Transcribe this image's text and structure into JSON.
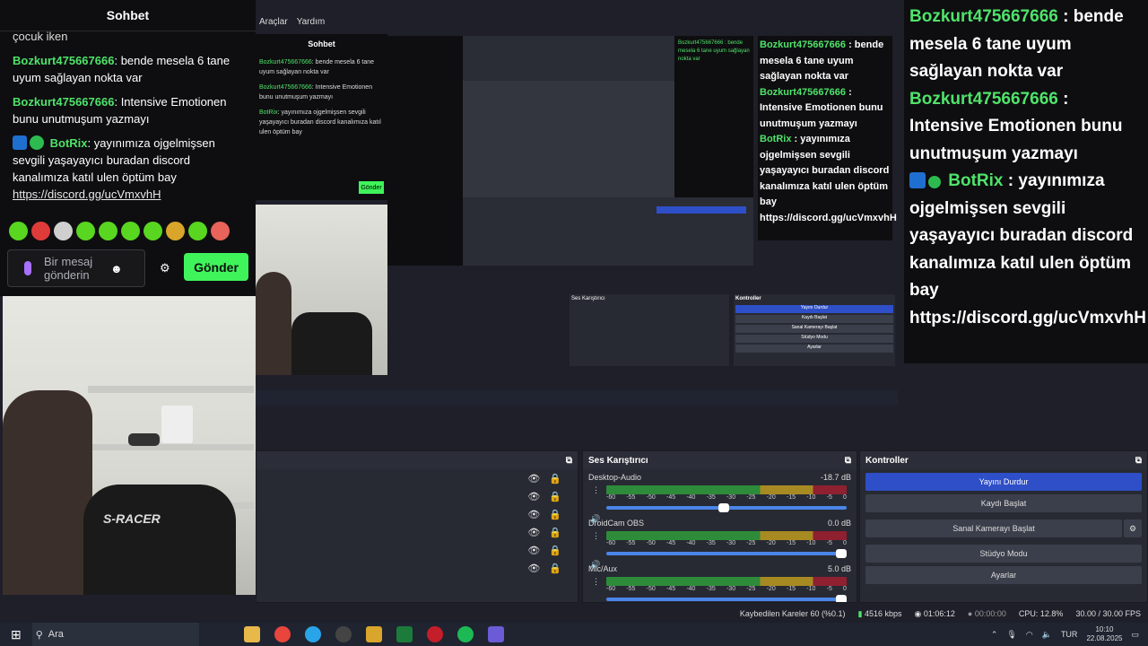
{
  "chat": {
    "header": "Sohbet",
    "partial_text": "çocuk iken",
    "messages": [
      {
        "user": "Bozkurt475667666",
        "text": ": bende mesela 6 tane uyum sağlayan nokta var"
      },
      {
        "user": "Bozkurt475667666",
        "text": ": Intensive Emotionen bunu unutmuşum yazmayı"
      },
      {
        "user": "BotRix",
        "text": ": yayınımıza ojgelmişsen sevgili yaşayayıcı buradan discord kanalımıza katıl ulen öptüm bay",
        "link": "https://discord.gg/ucVmxvhH"
      }
    ],
    "input_placeholder": "Bir mesaj gönderin",
    "send_label": "Gönder"
  },
  "overlay_chat": {
    "messages": [
      {
        "user": "Bozkurt475667666",
        "text": " : bende mesela 6 tane uyum sağlayan nokta var"
      },
      {
        "user": "Bozkurt475667666",
        "text": " : Intensive Emotionen bunu unutmuşum yazmayı"
      },
      {
        "user": "BotRix",
        "text": " : yayınımıza ojgelmişsen sevgili yaşayayıcı buradan discord kanalımıza katıl ulen öptüm bay https://discord.gg/ucVmxvhH"
      }
    ]
  },
  "menu": [
    "Araçlar",
    "Yardım"
  ],
  "mixer": {
    "title": "Ses Karıştırıcı",
    "ticks": [
      "-60",
      "-55",
      "-50",
      "-45",
      "-40",
      "-35",
      "-30",
      "-25",
      "-20",
      "-15",
      "-10",
      "-5",
      "0"
    ],
    "channels": [
      {
        "name": "Desktop-Audio",
        "db": "-18.7 dB",
        "volume": 0.49
      },
      {
        "name": "DroidCam OBS",
        "db": "0.0 dB",
        "volume": 1.0
      },
      {
        "name": "Mic/Aux",
        "db": "5.0 dB",
        "volume": 1.0
      }
    ]
  },
  "controls": {
    "title": "Kontroller",
    "buttons": [
      "Yayını Durdur",
      "Kaydı Başlat",
      "Sanal Kamerayı Başlat",
      "Stüdyo Modu",
      "Ayarlar"
    ]
  },
  "status": {
    "dropped": "Kaybedilen Kareler 60 (%0.1)",
    "bitrate": "4516 kbps",
    "stream_time": "01:06:12",
    "rec_time": "00:00:00",
    "cpu": "CPU: 12.8%",
    "fps": "30.00 / 30.00 FPS"
  },
  "taskbar": {
    "search_placeholder": "Ara",
    "lang": "TUR",
    "time": "10:10",
    "date": "22.08.2025"
  },
  "webcam": {
    "brand": "S-RACER"
  },
  "colors": {
    "accent": "#3ff45a",
    "username": "#4fe36a",
    "stream_button": "#2e4fc7"
  }
}
